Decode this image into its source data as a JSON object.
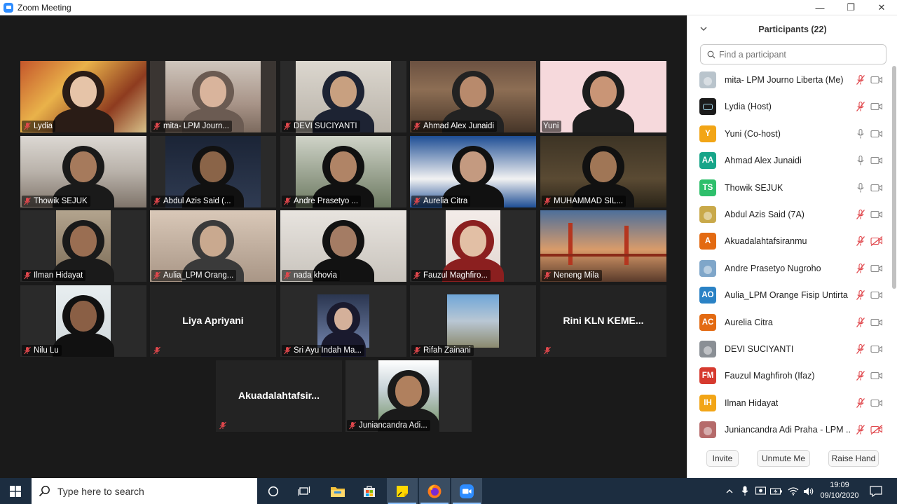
{
  "window": {
    "title": "Zoom Meeting"
  },
  "window_controls": {
    "minimize": "—",
    "maximize": "❐",
    "close": "✕"
  },
  "gallery": {
    "tiles": [
      {
        "name": "Lydia"
      },
      {
        "name": "mita- LPM Journ..."
      },
      {
        "name": "DEVI SUCIYANTI"
      },
      {
        "name": "Ahmad Alex Junaidi"
      },
      {
        "name": "Yuni"
      },
      {
        "name": "Thowik SEJUK"
      },
      {
        "name": "Abdul Azis Said (..."
      },
      {
        "name": "Andre Prasetyo ..."
      },
      {
        "name": "Aurelia Citra"
      },
      {
        "name": "MUHAMMAD SIL..."
      },
      {
        "name": "Ilman Hidayat"
      },
      {
        "name": "Aulia_LPM Orang..."
      },
      {
        "name": "nada khovia"
      },
      {
        "name": "Fauzul Maghfiro..."
      },
      {
        "name": "Neneng Mila"
      },
      {
        "name": "Nilu Lu"
      },
      {
        "big_name": "Liya Apriyani"
      },
      {
        "name": "Sri Ayu Indah Ma..."
      },
      {
        "name": "Rifah Zainani"
      },
      {
        "big_name": "Rini  KLN  KEME..."
      },
      {
        "big_name": "Akuadalahtafsir..."
      },
      {
        "name": "Juniancandra Adi..."
      }
    ]
  },
  "participants_panel": {
    "title": "Participants (22)",
    "search_placeholder": "Find a participant",
    "participants": [
      {
        "name": "mita- LPM Journo Liberta (Me)",
        "initials": "",
        "avatar_color": "#b9c4cc",
        "mic": "muted",
        "video": "on"
      },
      {
        "name": "Lydia (Host)",
        "initials": "",
        "avatar_color": "#1b1b1b",
        "mic": "muted",
        "video": "on"
      },
      {
        "name": "Yuni (Co-host)",
        "initials": "Y",
        "avatar_color": "#f2a516",
        "mic": "on",
        "video": "on"
      },
      {
        "name": "Ahmad Alex Junaidi",
        "initials": "AA",
        "avatar_color": "#17a589",
        "mic": "on",
        "video": "on"
      },
      {
        "name": "Thowik SEJUK",
        "initials": "TS",
        "avatar_color": "#2ebf6b",
        "mic": "on",
        "video": "on"
      },
      {
        "name": "Abdul Azis Said (7A)",
        "initials": "",
        "avatar_color": "#c9a94a",
        "mic": "muted",
        "video": "on"
      },
      {
        "name": "Akuadalahtafsiranmu",
        "initials": "A",
        "avatar_color": "#e36a12",
        "mic": "muted",
        "video": "off"
      },
      {
        "name": "Andre Prasetyo Nugroho",
        "initials": "",
        "avatar_color": "#7fa6c9",
        "mic": "muted",
        "video": "on"
      },
      {
        "name": "Aulia_LPM Orange Fisip Untirta",
        "initials": "AO",
        "avatar_color": "#2a82c5",
        "mic": "muted",
        "video": "on"
      },
      {
        "name": "Aurelia Citra",
        "initials": "AC",
        "avatar_color": "#e36a12",
        "mic": "muted",
        "video": "on"
      },
      {
        "name": "DEVI SUCIYANTI",
        "initials": "",
        "avatar_color": "#8a8f95",
        "mic": "muted",
        "video": "on"
      },
      {
        "name": "Fauzul Maghfiroh (Ifaz)",
        "initials": "FM",
        "avatar_color": "#d63a2f",
        "mic": "muted",
        "video": "on"
      },
      {
        "name": "Ilman Hidayat",
        "initials": "IH",
        "avatar_color": "#f2a516",
        "mic": "muted",
        "video": "on"
      },
      {
        "name": "Juniancandra Adi Praha - LPM ...",
        "initials": "",
        "avatar_color": "#b56a6a",
        "mic": "muted",
        "video": "off"
      }
    ],
    "buttons": {
      "invite": "Invite",
      "unmute_me": "Unmute Me",
      "raise_hand": "Raise Hand"
    }
  },
  "taskbar": {
    "search_placeholder": "Type here to search",
    "clock_time": "19:09",
    "clock_date": "09/10/2020"
  },
  "colors": {
    "accent": "#2d8cff",
    "muted_red": "#e0474c",
    "active_speaker": "#d9e36a"
  }
}
